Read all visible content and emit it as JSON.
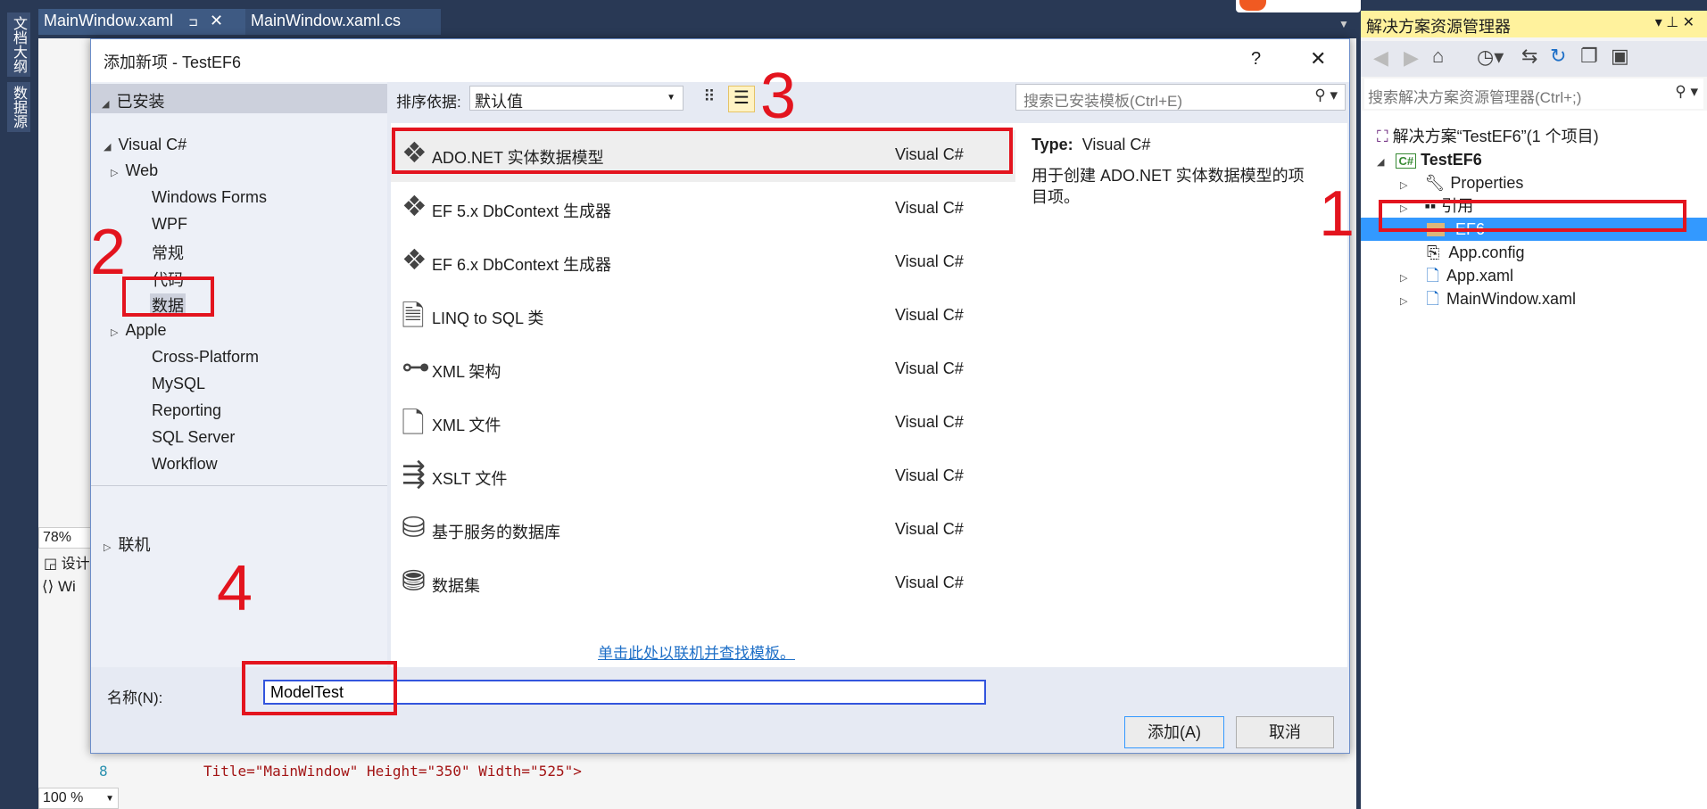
{
  "side_tabs": [
    "文档大纲",
    "数据源"
  ],
  "doc_tabs": [
    {
      "label": "MainWindow.xaml",
      "pin": "⊐",
      "close": "✕"
    },
    {
      "label": "MainWindow.xaml.cs"
    }
  ],
  "editor": {
    "zoom": "78%",
    "design_tab": "设计",
    "xaml_tab": "Wi",
    "line_number": "8",
    "code_line": "Title=\"MainWindow\" Height=\"350\" Width=\"525\">",
    "zoom_bottom": "100 %"
  },
  "dialog": {
    "title": "添加新项 - TestEF6",
    "help": "?",
    "close": "✕",
    "installed": "已安装",
    "tree": {
      "root": "Visual C#",
      "children": [
        "Web",
        "Windows Forms",
        "WPF",
        "常规",
        "代码",
        "数据",
        "Apple",
        "Cross-Platform",
        "MySQL",
        "Reporting",
        "SQL Server",
        "Workflow"
      ],
      "online": "联机"
    },
    "sort_label": "排序依据:",
    "sort_value": "默认值",
    "search_placeholder": "搜索已安装模板(Ctrl+E)",
    "templates": [
      {
        "name": "ADO.NET 实体数据模型",
        "type": "Visual C#",
        "icon": "entity-model-icon"
      },
      {
        "name": "EF 5.x DbContext 生成器",
        "type": "Visual C#",
        "icon": "entity-model-icon"
      },
      {
        "name": "EF 6.x DbContext 生成器",
        "type": "Visual C#",
        "icon": "entity-model-icon"
      },
      {
        "name": "LINQ to SQL 类",
        "type": "Visual C#",
        "icon": "linq-icon"
      },
      {
        "name": "XML 架构",
        "type": "Visual C#",
        "icon": "xml-schema-icon"
      },
      {
        "name": "XML 文件",
        "type": "Visual C#",
        "icon": "xml-file-icon"
      },
      {
        "name": "XSLT 文件",
        "type": "Visual C#",
        "icon": "xslt-icon"
      },
      {
        "name": "基于服务的数据库",
        "type": "Visual C#",
        "icon": "database-icon"
      },
      {
        "name": "数据集",
        "type": "Visual C#",
        "icon": "dataset-icon"
      }
    ],
    "online_link": "单击此处以联机并查找模板。",
    "detail_type_label": "Type:",
    "detail_type_value": "Visual C#",
    "detail_desc": "用于创建 ADO.NET 实体数据模型的项目项。",
    "name_label": "名称(N):",
    "name_value": "ModelTest",
    "add": "添加(A)",
    "cancel": "取消"
  },
  "solution_explorer": {
    "title": "解决方案资源管理器",
    "search_placeholder": "搜索解决方案资源管理器(Ctrl+;)",
    "items": [
      {
        "label": "解决方案“TestEF6”(1 个项目)"
      },
      {
        "label": "TestEF6"
      },
      {
        "label": "Properties"
      },
      {
        "label": "引用"
      },
      {
        "label": "EF6",
        "selected": true
      },
      {
        "label": "App.config"
      },
      {
        "label": "App.xaml"
      },
      {
        "label": "MainWindow.xaml"
      }
    ]
  },
  "annotations": [
    "1",
    "2",
    "3",
    "4"
  ],
  "colors": {
    "annotation": "#e3141e",
    "selection": "#3399ff",
    "header_yellow": "#fff29d",
    "frame": "#293955"
  }
}
